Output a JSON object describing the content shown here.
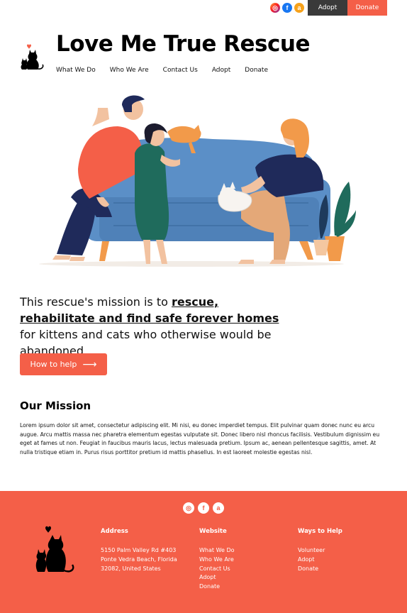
{
  "topbar": {
    "social": [
      {
        "icon": "instagram-icon",
        "glyph": "◎"
      },
      {
        "icon": "facebook-icon",
        "glyph": "f"
      },
      {
        "icon": "amazon-icon",
        "glyph": "a"
      }
    ],
    "adopt_label": "Adopt",
    "donate_label": "Donate"
  },
  "header": {
    "title": "Love Me True Rescue",
    "nav": [
      "What We Do",
      "Who We Are",
      "Contact Us",
      "Adopt",
      "Donate"
    ]
  },
  "statement": {
    "intro": "This rescue's mission is to ",
    "emphasis": "rescue, rehabilitate and find safe forever homes",
    "outro": " for kittens and cats who otherwise would be abandoned."
  },
  "help_button": {
    "label": "How to help",
    "arrow": "⟶"
  },
  "mission": {
    "title": "Our  Mission",
    "body": "Lorem ipsum dolor sit amet, consectetur adipiscing elit. Mi nisi, eu donec imperdiet tempus. Elit pulvinar quam donec nunc eu arcu augue. Arcu mattis massa nec pharetra elementum egestas vulputate sit. Donec libero nisl rhoncus facilisis. Vestibulum dignissim eu eget at fames ut non. Feugiat in faucibus mauris lacus, lectus malesuada pretium. Ipsum ac, aenean pellentesque sagittis, amet. At nulla tristique etiam in. Purus risus porttitor pretium id mattis phasellus. In est laoreet molestie egestas nisl."
  },
  "footer": {
    "social": [
      {
        "icon": "instagram-icon",
        "glyph": "◎"
      },
      {
        "icon": "facebook-icon",
        "glyph": "f"
      },
      {
        "icon": "amazon-icon",
        "glyph": "a"
      }
    ],
    "address": {
      "heading": "Address",
      "lines": [
        "5150 Palm Valley Rd #403",
        "Ponte Vedra Beach, Florida",
        "32082, United States"
      ]
    },
    "website": {
      "heading": "Website",
      "links": [
        "What We Do",
        "Who We Are",
        "Contact Us",
        "Adopt",
        "Donate"
      ]
    },
    "ways": {
      "heading": "Ways to Help",
      "links": [
        "Volunteer",
        "Adopt",
        "Donate"
      ]
    }
  },
  "colors": {
    "accent": "#f45f48",
    "dark_button": "#3a3a3a",
    "sofa": "#5b8fc7",
    "text": "#111111"
  }
}
